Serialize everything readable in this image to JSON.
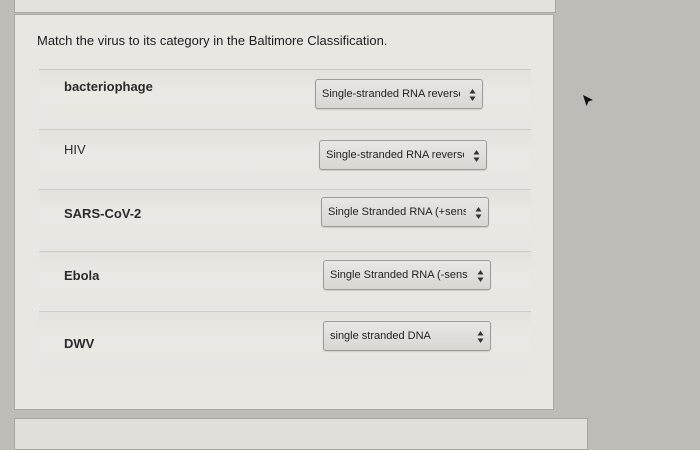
{
  "question": "Match the virus to its category in the Baltimore Classification.",
  "rows": [
    {
      "virus": "bacteriophage",
      "selected": "Single-stranded RNA reverse t"
    },
    {
      "virus": "HIV",
      "selected": "Single-stranded RNA reverse t"
    },
    {
      "virus": "SARS-CoV-2",
      "selected": "Single Stranded RNA (+sense :"
    },
    {
      "virus": "Ebola",
      "selected": "Single Stranded RNA (-sense s"
    },
    {
      "virus": "DWV",
      "selected": "single stranded DNA"
    }
  ],
  "icons": {
    "dropdown": "updown-arrows-icon",
    "cursor": "mouse-pointer-icon"
  }
}
